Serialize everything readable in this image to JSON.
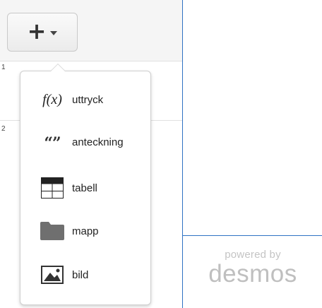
{
  "toolbar": {
    "add_button_icon": "plus-icon",
    "add_button_caret": "caret-down-icon"
  },
  "expression_list": {
    "rows": [
      {
        "index": "1"
      },
      {
        "index": "2"
      }
    ]
  },
  "add_menu": {
    "items": [
      {
        "icon": "function-icon",
        "icon_text": "f(x)",
        "label": "uttryck"
      },
      {
        "icon": "quote-icon",
        "icon_text": "“”",
        "label": "anteckning"
      },
      {
        "icon": "table-icon",
        "label": "tabell"
      },
      {
        "icon": "folder-icon",
        "label": "mapp"
      },
      {
        "icon": "image-icon",
        "label": "bild"
      }
    ]
  },
  "branding": {
    "powered_by": "powered by",
    "brand": "desmos"
  },
  "colors": {
    "accent_blue": "#2f72c3",
    "branding_gray": "#c4c4c4",
    "folder_gray": "#6f6f6f"
  }
}
